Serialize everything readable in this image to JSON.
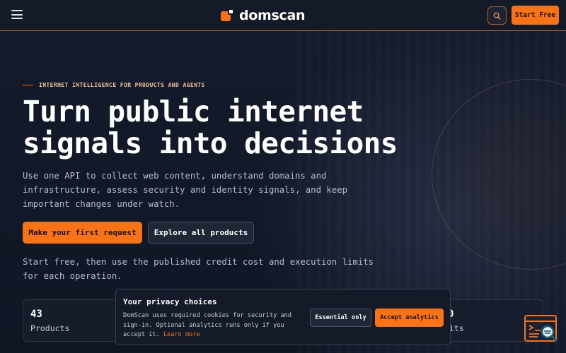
{
  "header": {
    "brand_name": "domscan",
    "start_label": "Start Free"
  },
  "hero": {
    "eyebrow": "INTERNET INTELLIGENCE FOR PRODUCTS AND AGENTS",
    "title_lines": [
      "Turn public internet",
      "signals into decisions"
    ],
    "subtitle_lines": [
      "Use one API to collect web content, understand domains and",
      "infrastructure, assess security and identity signals, and keep",
      "important changes under watch."
    ],
    "primary_cta": "Make your first request",
    "secondary_cta": "Explore all products",
    "note_lines": [
      "Start free, then use the published credit cost and execution limits",
      "for each operation."
    ]
  },
  "stats": [
    {
      "value": "43",
      "label": "Products"
    },
    {
      "value": "0",
      "label": "edits"
    }
  ],
  "privacy": {
    "title": "Your privacy choices",
    "text_lines": [
      "DomScan uses required cookies for security and",
      "sign-in. Optional analytics runs only if you",
      "accept it."
    ],
    "learn_more": "Learn more",
    "essential_label": "Essential only",
    "accept_label": "Accept analytics"
  },
  "icons": {
    "menu": "hamburger-menu-icon",
    "search": "search-icon",
    "widget": "terminal-search-icon"
  },
  "colors": {
    "accent": "#f97316",
    "background": "#111827"
  }
}
